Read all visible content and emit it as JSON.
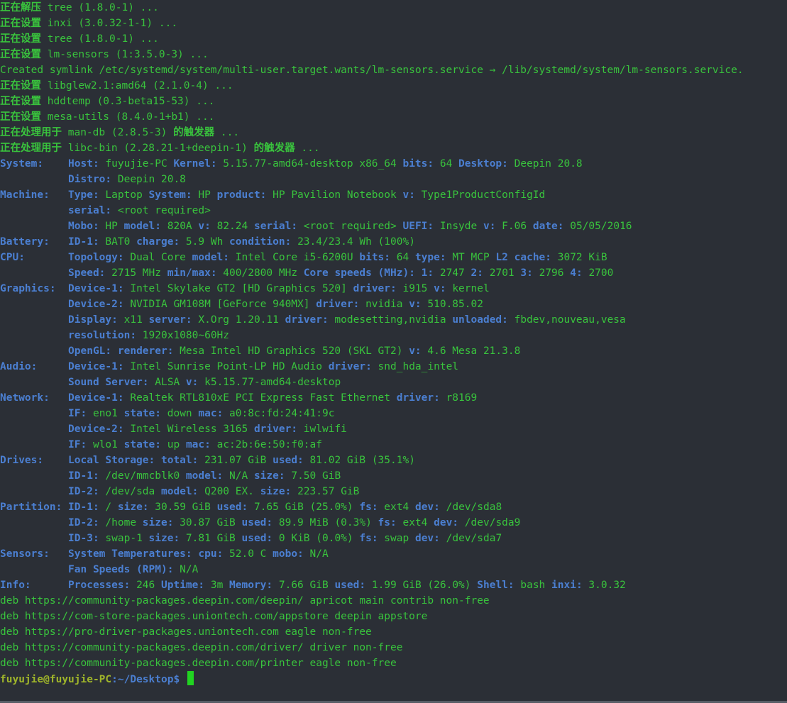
{
  "install_log": [
    {
      "prefix": "正在解压",
      "pkg": " tree (1.8.0-1) ..."
    },
    {
      "prefix": "正在设置",
      "pkg": " inxi (3.0.32-1-1) ..."
    },
    {
      "prefix": "正在设置",
      "pkg": " tree (1.8.0-1) ..."
    },
    {
      "prefix": "正在设置",
      "pkg": " lm-sensors (1:3.5.0-3) ..."
    }
  ],
  "symlink_line": "Created symlink /etc/systemd/system/multi-user.target.wants/lm-sensors.service → /lib/systemd/system/lm-sensors.service.",
  "install_log2": [
    {
      "prefix": "正在设置",
      "pkg": " libglew2.1:amd64 (2.1.0-4) ..."
    },
    {
      "prefix": "正在设置",
      "pkg": " hddtemp (0.3-beta15-53) ..."
    },
    {
      "prefix": "正在设置",
      "pkg": " mesa-utils (8.4.0-1+b1) ..."
    }
  ],
  "triggers": [
    {
      "prefix": "正在处理用于",
      "pkg": " man-db (2.8.5-3) ",
      "suffix": "的触发器",
      "dots": " ..."
    },
    {
      "prefix": "正在处理用于",
      "pkg": " libc-bin (2.28.21-1+deepin-1) ",
      "suffix": "的触发器",
      "dots": " ..."
    }
  ],
  "inxi": {
    "system": {
      "section": "System:    ",
      "k1": "Host:",
      "v1": " fuyujie-PC ",
      "k2": "Kernel:",
      "v2": " 5.15.77-amd64-desktop x86_64 ",
      "k3": "bits:",
      "v3": " 64 ",
      "k4": "Desktop:",
      "v4": " Deepin 20.8",
      "indent": "           ",
      "k5": "Distro:",
      "v5": " Deepin 20.8"
    },
    "machine": {
      "section": "Machine:   ",
      "k1": "Type:",
      "v1": " Laptop ",
      "k2": "System:",
      "v2": " HP ",
      "k3": "product:",
      "v3": " HP Pavilion Notebook ",
      "k4": "v:",
      "v4": " Type1ProductConfigId",
      "indent": "           ",
      "k5": "serial:",
      "v5": " <root required>",
      "k6": "Mobo:",
      "v6": " HP ",
      "k7": "model:",
      "v7": " 820A ",
      "k8": "v:",
      "v8": " 82.24 ",
      "k9": "serial:",
      "v9": " <root required> ",
      "k10": "UEFI:",
      "v10": " Insyde ",
      "k11": "v:",
      "v11": " F.06 ",
      "k12": "date:",
      "v12": " 05/05/2016"
    },
    "battery": {
      "section": "Battery:   ",
      "k1": "ID-1:",
      "v1": " BAT0 ",
      "k2": "charge:",
      "v2": " 5.9 Wh ",
      "k3": "condition:",
      "v3": " 23.4/23.4 Wh (100%)"
    },
    "cpu": {
      "section": "CPU:       ",
      "k1": "Topology:",
      "v1": " Dual Core ",
      "k2": "model:",
      "v2": " Intel Core i5-6200U ",
      "k3": "bits:",
      "v3": " 64 ",
      "k4": "type:",
      "v4": " MT MCP ",
      "k5": "L2 cache:",
      "v5": " 3072 KiB",
      "indent": "           ",
      "k6": "Speed:",
      "v6": " 2715 MHz ",
      "k7": "min/max:",
      "v7": " 400/2800 MHz ",
      "k8": "Core speeds (MHz):",
      "v8": " ",
      "k9": "1:",
      "v9": " 2747 ",
      "k10": "2:",
      "v10": " 2701 ",
      "k11": "3:",
      "v11": " 2796 ",
      "k12": "4:",
      "v12": " 2700"
    },
    "graphics": {
      "section": "Graphics:  ",
      "k1": "Device-1:",
      "v1": " Intel Skylake GT2 [HD Graphics 520] ",
      "k2": "driver:",
      "v2": " i915 ",
      "k3": "v:",
      "v3": " kernel",
      "indent": "           ",
      "k4": "Device-2:",
      "v4": " NVIDIA GM108M [GeForce 940MX] ",
      "k5": "driver:",
      "v5": " nvidia ",
      "k6": "v:",
      "v6": " 510.85.02",
      "k7": "Display:",
      "v7": " x11 ",
      "k8": "server:",
      "v8": " X.Org 1.20.11 ",
      "k9": "driver:",
      "v9": " modesetting,nvidia ",
      "k10": "unloaded:",
      "v10": " fbdev,nouveau,vesa",
      "k11": "resolution:",
      "v11": " 1920x1080~60Hz",
      "k12": "OpenGL:",
      "v12": " ",
      "k13": "renderer:",
      "v13": " Mesa Intel HD Graphics 520 (SKL GT2) ",
      "k14": "v:",
      "v14": " 4.6 Mesa 21.3.8"
    },
    "audio": {
      "section": "Audio:     ",
      "k1": "Device-1:",
      "v1": " Intel Sunrise Point-LP HD Audio ",
      "k2": "driver:",
      "v2": " snd_hda_intel",
      "indent": "           ",
      "k3": "Sound Server:",
      "v3": " ALSA ",
      "k4": "v:",
      "v4": " k5.15.77-amd64-desktop"
    },
    "network": {
      "section": "Network:   ",
      "k1": "Device-1:",
      "v1": " Realtek RTL810xE PCI Express Fast Ethernet ",
      "k2": "driver:",
      "v2": " r8169",
      "indent": "           ",
      "k3": "IF:",
      "v3": " eno1 ",
      "k4": "state:",
      "v4": " down ",
      "k5": "mac:",
      "v5": " a0:8c:fd:24:41:9c",
      "k6": "Device-2:",
      "v6": " Intel Wireless 3165 ",
      "k7": "driver:",
      "v7": " iwlwifi",
      "k8": "IF:",
      "v8": " wlo1 ",
      "k9": "state:",
      "v9": " up ",
      "k10": "mac:",
      "v10": " ac:2b:6e:50:f0:af"
    },
    "drives": {
      "section": "Drives:    ",
      "k1": "Local Storage:",
      "v1": " ",
      "k2": "total:",
      "v2": " 231.07 GiB ",
      "k3": "used:",
      "v3": " 81.02 GiB (35.1%)",
      "indent": "           ",
      "k4": "ID-1:",
      "v4": " /dev/mmcblk0 ",
      "k5": "model:",
      "v5": " N/A ",
      "k6": "size:",
      "v6": " 7.50 GiB",
      "k7": "ID-2:",
      "v7": " /dev/sda ",
      "k8": "model:",
      "v8": " Q200 EX. ",
      "k9": "size:",
      "v9": " 223.57 GiB"
    },
    "partition": {
      "section": "Partition: ",
      "k1": "ID-1:",
      "v1": " / ",
      "k2": "size:",
      "v2": " 30.59 GiB ",
      "k3": "used:",
      "v3": " 7.65 GiB (25.0%) ",
      "k4": "fs:",
      "v4": " ext4 ",
      "k5": "dev:",
      "v5": " /dev/sda8",
      "indent": "           ",
      "k6": "ID-2:",
      "v6": " /home ",
      "k7": "size:",
      "v7": " 30.87 GiB ",
      "k8": "used:",
      "v8": " 89.9 MiB (0.3%) ",
      "k9": "fs:",
      "v9": " ext4 ",
      "k10": "dev:",
      "v10": " /dev/sda9",
      "k11": "ID-3:",
      "v11": " swap-1 ",
      "k12": "size:",
      "v12": " 7.81 GiB ",
      "k13": "used:",
      "v13": " 0 KiB (0.0%) ",
      "k14": "fs:",
      "v14": " swap ",
      "k15": "dev:",
      "v15": " /dev/sda7"
    },
    "sensors": {
      "section": "Sensors:   ",
      "k1": "System Temperatures:",
      "v1": " ",
      "k2": "cpu:",
      "v2": " 52.0 C ",
      "k3": "mobo:",
      "v3": " N/A",
      "indent": "           ",
      "k4": "Fan Speeds (RPM):",
      "v4": " N/A"
    },
    "info": {
      "section": "Info:      ",
      "k1": "Processes:",
      "v1": " 246 ",
      "k2": "Uptime:",
      "v2": " 3m ",
      "k3": "Memory:",
      "v3": " 7.66 GiB ",
      "k4": "used:",
      "v4": " 1.99 GiB (26.0%) ",
      "k5": "Shell:",
      "v5": " bash ",
      "k6": "inxi:",
      "v6": " 3.0.32"
    }
  },
  "sources": [
    "deb https://community-packages.deepin.com/deepin/ apricot main contrib non-free",
    "deb https://com-store-packages.uniontech.com/appstore deepin appstore",
    "deb https://pro-driver-packages.uniontech.com eagle non-free",
    "deb https://community-packages.deepin.com/driver/ driver non-free",
    "deb https://community-packages.deepin.com/printer eagle non-free"
  ],
  "prompt": {
    "user_host": "fuyujie@fuyujie-PC",
    "sep": ":",
    "path": "~/Desktop",
    "symbol": "$ "
  },
  "colors": {
    "background": "#2b2f36",
    "text_green": "#39c33d",
    "key_blue": "#4b7fd1",
    "prompt_user": "#9fb52a",
    "cursor": "#21d321"
  }
}
